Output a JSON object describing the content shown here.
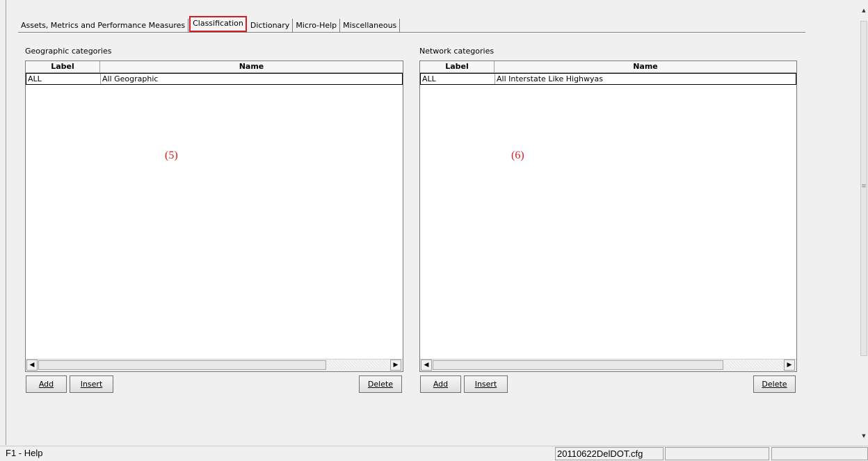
{
  "tabs": [
    {
      "label": "Assets, Metrics and Performance Measures",
      "active": false
    },
    {
      "label": "Classification",
      "active": true
    },
    {
      "label": "Dictionary",
      "active": false
    },
    {
      "label": "Micro-Help",
      "active": false
    },
    {
      "label": "Miscellaneous",
      "active": false
    }
  ],
  "geographic": {
    "title": "Geographic categories",
    "columns": [
      "Label",
      "Name"
    ],
    "rows": [
      [
        "ALL",
        "All Geographic"
      ]
    ],
    "marker": "(5)",
    "buttons": {
      "add": "Add",
      "insert": "Insert",
      "delete": "Delete"
    }
  },
  "network": {
    "title": "Network categories",
    "columns": [
      "Label",
      "Name"
    ],
    "rows": [
      [
        "ALL",
        "All Interstate Like Highwyas"
      ]
    ],
    "marker": "(6)",
    "buttons": {
      "add": "Add",
      "insert": "Insert",
      "delete": "Delete"
    }
  },
  "statusbar": {
    "help": "F1 - Help",
    "file": "20110622DelDOT.cfg",
    "panel2": "",
    "panel3": ""
  },
  "colors": {
    "highlight": "#d81b23"
  }
}
